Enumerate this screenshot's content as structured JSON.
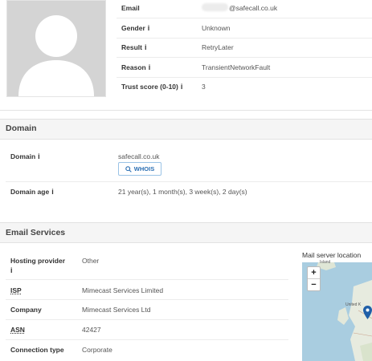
{
  "profile": {
    "fields": [
      {
        "label": "Email",
        "value": "@safecall.co.uk",
        "info": false
      },
      {
        "label": "Gender",
        "value": "Unknown",
        "info": true
      },
      {
        "label": "Result",
        "value": "RetryLater",
        "info": true
      },
      {
        "label": "Reason",
        "value": "TransientNetworkFault",
        "info": true
      },
      {
        "label": "Trust score (0-10)",
        "value": "3",
        "info": true
      }
    ]
  },
  "domain": {
    "title": "Domain",
    "domain_label": "Domain",
    "domain_value": "safecall.co.uk",
    "whois_label": "WHOIS",
    "age_label": "Domain age",
    "age_value": "21 year(s), 1 month(s), 3 week(s), 2 day(s)"
  },
  "email_services": {
    "title": "Email Services",
    "map_title": "Mail server location",
    "map_label_1": "Island",
    "map_label_2": "United K",
    "zoom_in": "+",
    "zoom_out": "−",
    "rows": [
      {
        "label": "Hosting provider",
        "value": "Other"
      },
      {
        "label": "ISP",
        "value": "Mimecast Services Limited"
      },
      {
        "label": "Company",
        "value": "Mimecast Services Ltd"
      },
      {
        "label": "ASN",
        "value": "42427"
      },
      {
        "label": "Connection type",
        "value": "Corporate"
      }
    ]
  },
  "colors": {
    "accent": "#2b6fb3",
    "map_marker": "#1f5fa8"
  }
}
